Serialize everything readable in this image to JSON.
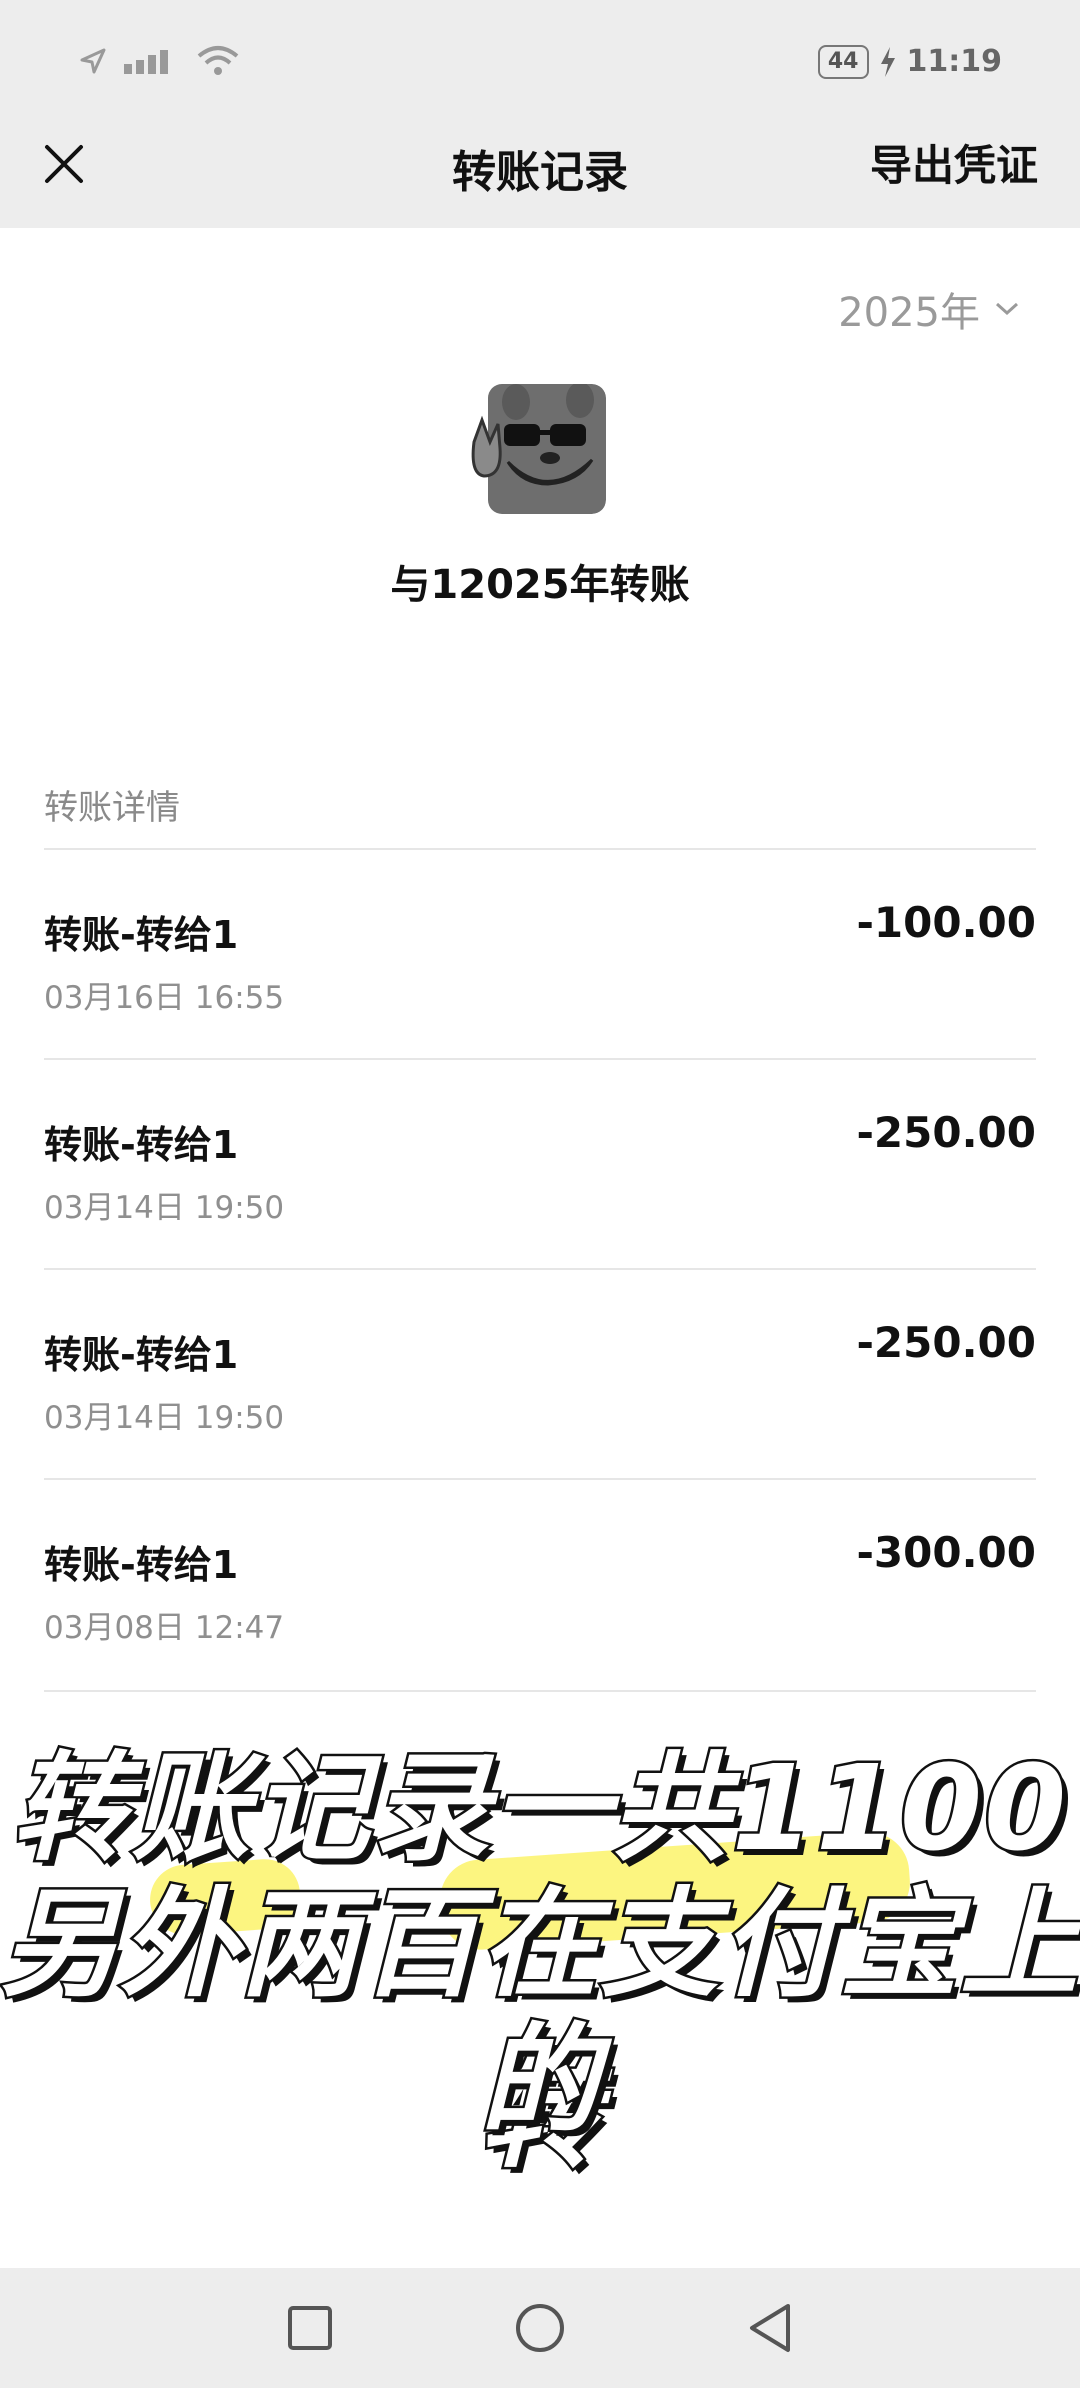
{
  "status_bar": {
    "battery": "44",
    "time": "11:19"
  },
  "header": {
    "title": "转账记录",
    "export_label": "导出凭证"
  },
  "year_selector": {
    "value": "2025年"
  },
  "contact": {
    "title": "与12025年转账"
  },
  "section": {
    "label": "转账详情"
  },
  "transactions": [
    {
      "title": "转账-转给1",
      "time": "03月16日 16:55",
      "amount": "-100.00"
    },
    {
      "title": "转账-转给1",
      "time": "03月14日 19:50",
      "amount": "-250.00"
    },
    {
      "title": "转账-转给1",
      "time": "03月14日 19:50",
      "amount": "-250.00"
    },
    {
      "title": "转账-转给1",
      "time": "03月08日 12:47",
      "amount": "-300.00"
    }
  ],
  "caption": {
    "line1": "转账记录一共1100",
    "line2": "另外两百在支付宝上转",
    "line3": "的"
  },
  "colors": {
    "bar_bg": "#ededed",
    "caption_highlight": "#fbf36a"
  },
  "icons": {
    "close": "close-icon",
    "year_dropdown": "chevron-down-icon",
    "nav_recents": "square-icon",
    "nav_home": "circle-icon",
    "nav_back": "triangle-back-icon"
  }
}
